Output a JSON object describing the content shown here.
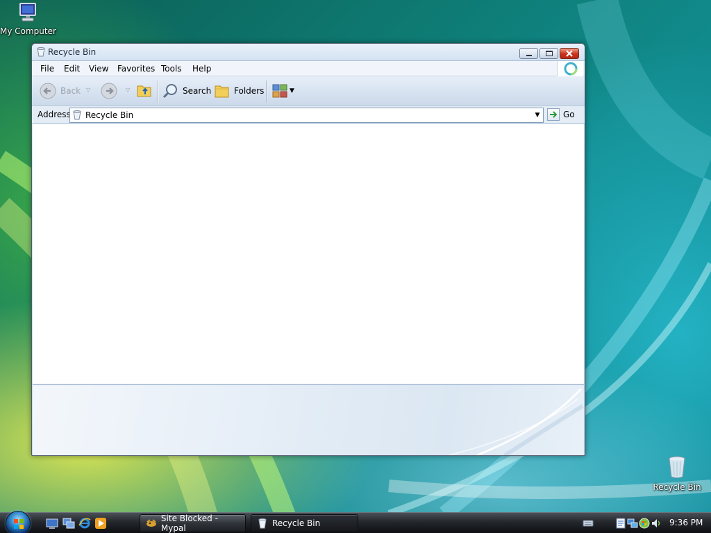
{
  "desktop": {
    "icons": [
      {
        "label": "My Computer"
      },
      {
        "label": "Recycle Bin"
      }
    ]
  },
  "window": {
    "title": "Recycle Bin",
    "menu": [
      "File",
      "Edit",
      "View",
      "Favorites",
      "Tools",
      "Help"
    ],
    "toolbar": {
      "back_label": "Back",
      "search_label": "Search",
      "folders_label": "Folders"
    },
    "address": {
      "label": "Address",
      "value": "Recycle Bin",
      "go_label": "Go"
    }
  },
  "taskbar": {
    "tasks": [
      {
        "label": "Site Blocked - Mypal"
      },
      {
        "label": "Recycle Bin"
      }
    ],
    "clock": "9:36 PM"
  },
  "colors": {
    "accent": "#3a8fd0",
    "close_button": "#c9331e",
    "taskbar": "#24272c"
  }
}
